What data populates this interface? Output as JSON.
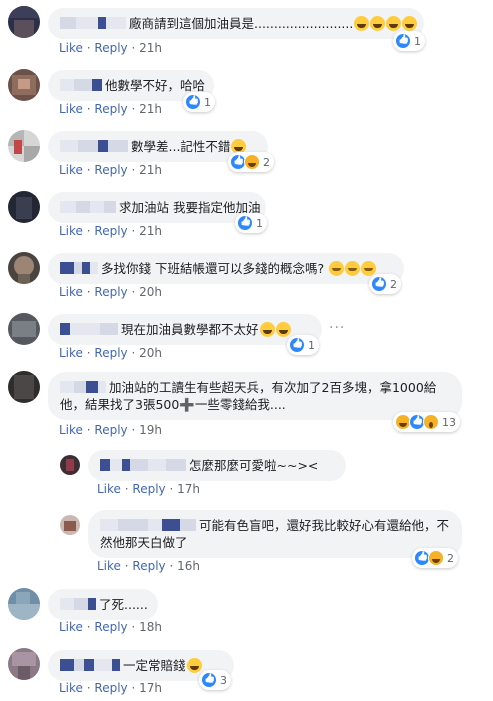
{
  "colors": {
    "link": "#4267b2",
    "meta": "#606770",
    "bubble": "#f2f3f5",
    "like": "#2d88ff",
    "haha": "#f7b125"
  },
  "comments": [
    {
      "text": "廠商請到這個加油員是.........................",
      "emoji": [
        "haha",
        "haha",
        "haha",
        "haha"
      ],
      "like": "Like",
      "reply": "Reply",
      "time": "21h",
      "reactions": [
        "like"
      ],
      "count": "1"
    },
    {
      "text": "他數學不好，哈哈",
      "like": "Like",
      "reply": "Reply",
      "time": "21h",
      "reactions": [
        "like"
      ],
      "count": "1"
    },
    {
      "text": "數學差...記性不錯",
      "emoji": [
        "haha"
      ],
      "like": "Like",
      "reply": "Reply",
      "time": "21h",
      "reactions": [
        "like",
        "haha"
      ],
      "count": "2"
    },
    {
      "text": "求加油站 我要指定他加油",
      "like": "Like",
      "reply": "Reply",
      "time": "21h",
      "reactions": [
        "like"
      ],
      "count": "1"
    },
    {
      "text": "多找你錢 下班結帳還可以多錢的概念嗎?",
      "emoji": [
        "smile",
        "smile",
        "smile"
      ],
      "like": "Like",
      "reply": "Reply",
      "time": "20h",
      "reactions": [
        "like"
      ],
      "count": "2"
    },
    {
      "text": "現在加油員數學都不太好",
      "emoji": [
        "haha",
        "haha"
      ],
      "like": "Like",
      "reply": "Reply",
      "time": "20h",
      "reactions": [
        "like"
      ],
      "count": "1",
      "more": "···"
    },
    {
      "text": "加油站的工讀生有些超天兵，有次加了2百多塊，拿1000給他，結果找了3張500➕一些零錢給我....",
      "like": "Like",
      "reply": "Reply",
      "time": "19h",
      "reactions": [
        "haha",
        "like",
        "wow"
      ],
      "count": "13"
    },
    {
      "text": "怎麼那麼可愛啦~~><",
      "like": "Like",
      "reply": "Reply",
      "time": "17h"
    },
    {
      "text": "可能有色盲吧，還好我比較好心有還給他，不然他那天白做了",
      "like": "Like",
      "reply": "Reply",
      "time": "16h",
      "reactions": [
        "like",
        "haha"
      ],
      "count": "2"
    },
    {
      "text": "了死......",
      "like": "Like",
      "reply": "Reply",
      "time": "18h"
    },
    {
      "text": "一定常賠錢",
      "emoji": [
        "haha"
      ],
      "like": "Like",
      "reply": "Reply",
      "time": "17h",
      "reactions": [
        "like"
      ],
      "count": "3"
    }
  ]
}
